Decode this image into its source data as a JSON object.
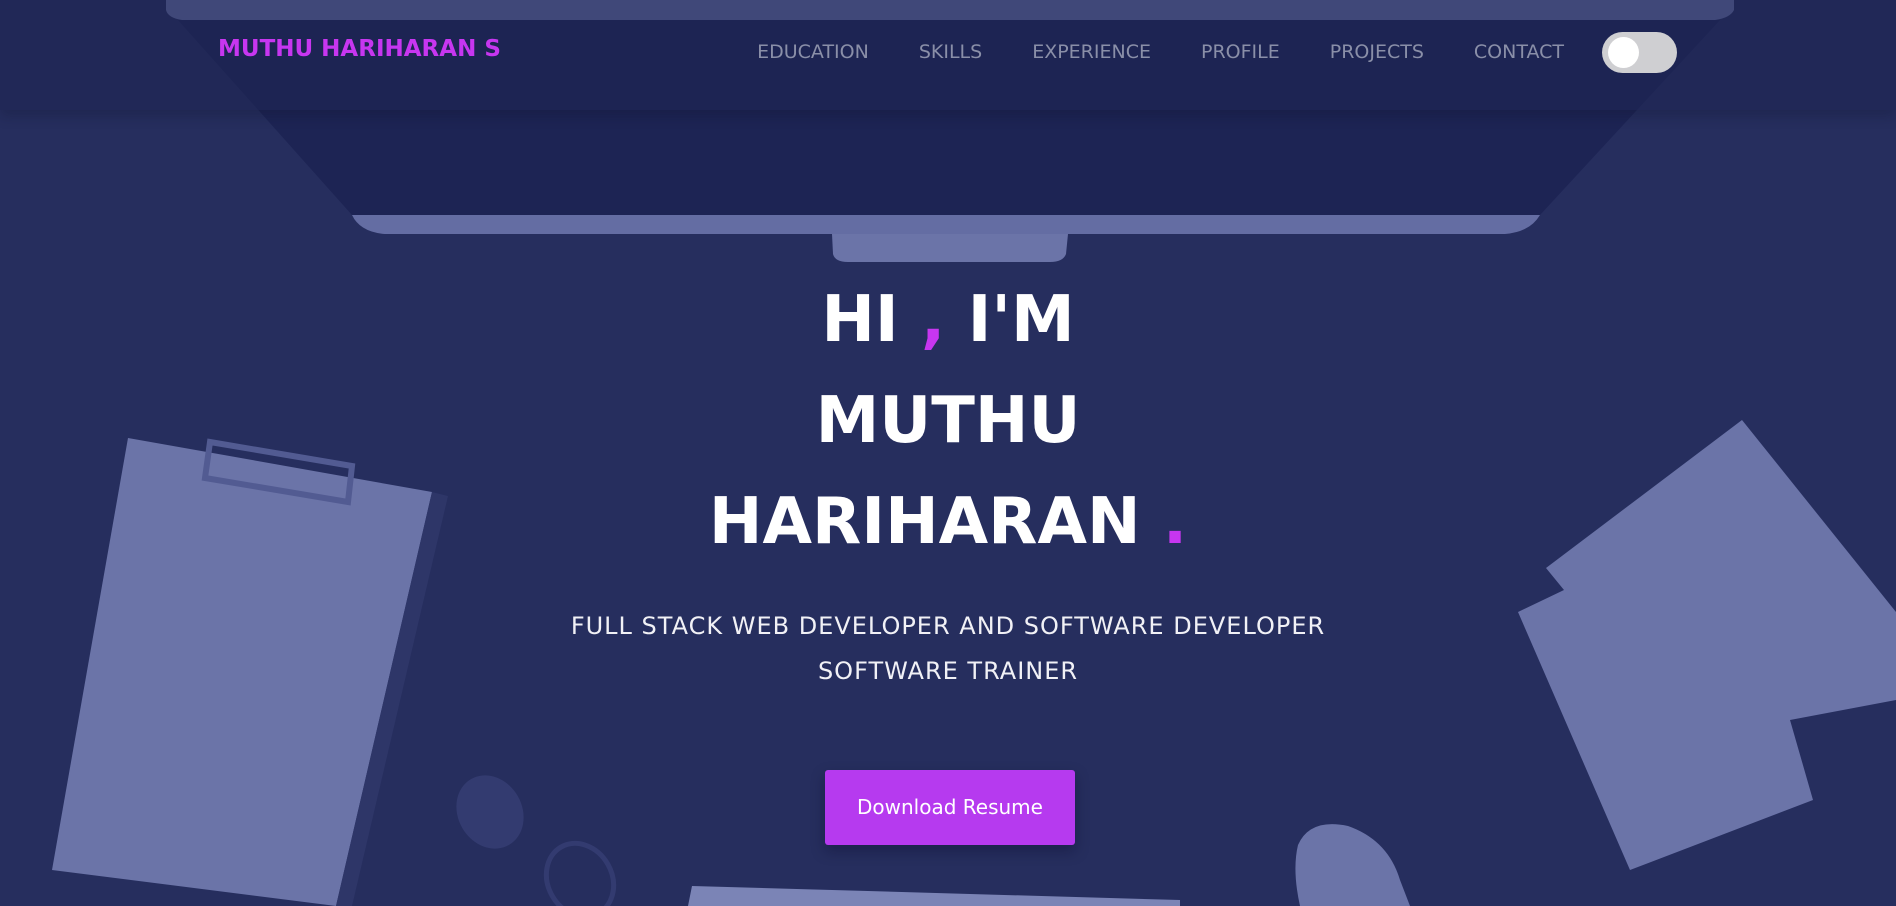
{
  "header": {
    "brand": "MUTHU HARIHARAN S",
    "nav": [
      "EDUCATION",
      "SKILLS",
      "EXPERIENCE",
      "PROFILE",
      "PROJECTS",
      "CONTACT"
    ],
    "theme_toggle": {
      "state": "off",
      "icon": "toggle-switch"
    }
  },
  "hero": {
    "greeting_hi": "HI",
    "greeting_comma": ",",
    "greeting_im": "I'M",
    "name_first": "MUTHU",
    "name_last": "HARIHARAN",
    "name_dot": ".",
    "subtitle_line1": "FULL STACK WEB DEVELOPER AND SOFTWARE DEVELOPER",
    "subtitle_line2": "SOFTWARE TRAINER",
    "cta_label": "Download Resume"
  },
  "colors": {
    "background": "#262e5e",
    "accent": "#c736f0",
    "button": "#b63aef",
    "nav_text": "#8a8fa8",
    "illustration": "#6b74a8"
  }
}
